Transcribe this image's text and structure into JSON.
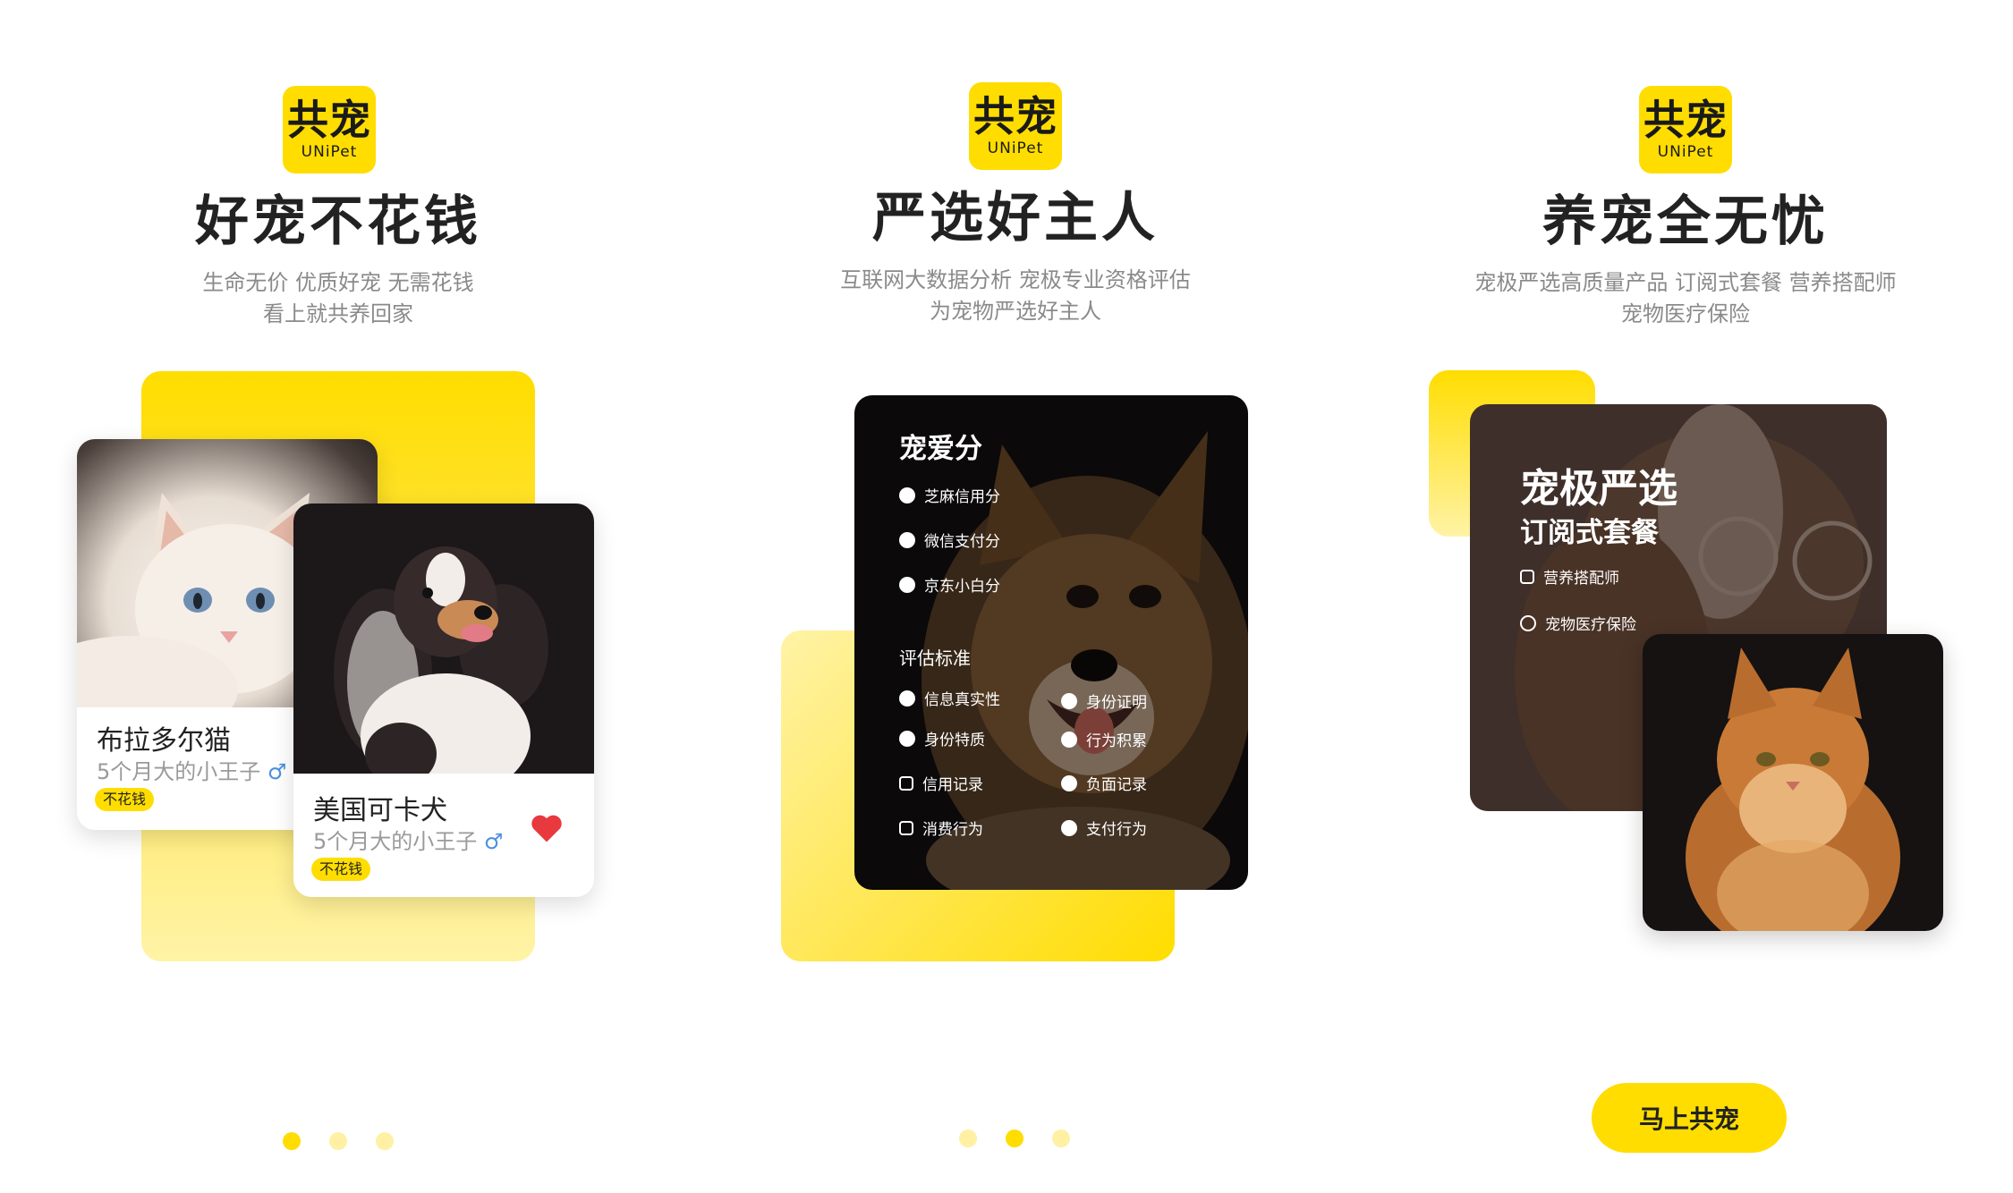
{
  "colors": {
    "brand_yellow": "#FFDD00",
    "light_yellow": "#FFF3A6",
    "text_dark": "#222222",
    "text_gray": "#8a8a8a",
    "heart_red": "#E8393E",
    "male_blue": "#4A90E2"
  },
  "logo": {
    "cn": "共宠",
    "en": "UNiPet"
  },
  "screen1": {
    "title": "好宠不花钱",
    "subtitle_line1": "生命无价  优质好宠  无需花钱",
    "subtitle_line2": "看上就共养回家",
    "cat_card": {
      "name": "布拉多尔猫",
      "desc": "5个月大的小王子",
      "gender": "♂",
      "badge": "不花钱"
    },
    "dog_card": {
      "name": "美国可卡犬",
      "desc": "5个月大的小王子",
      "gender": "♂",
      "badge": "不花钱",
      "heart_icon": "heart-icon"
    },
    "pager": {
      "total": 3,
      "active": 1
    }
  },
  "screen2": {
    "title": "严选好主人",
    "subtitle_line1": "互联网大数据分析  宠极专业资格评估",
    "subtitle_line2": "为宠物严选好主人",
    "score_title": "宠爱分",
    "score_items": [
      "芝麻信用分",
      "微信支付分",
      "京东小白分"
    ],
    "criteria_title": "评估标准",
    "criteria_left": [
      "信息真实性",
      "身份特质",
      "信用记录",
      "消费行为"
    ],
    "criteria_right": [
      "身份证明",
      "行为积累",
      "负面记录",
      "支付行为"
    ],
    "pager": {
      "total": 3,
      "active": 2
    }
  },
  "screen3": {
    "title": "养宠全无忧",
    "subtitle_line1": "宠极严选高质量产品  订阅式套餐  营养搭配师",
    "subtitle_line2": "宠物医疗保险",
    "card_title": "宠极严选",
    "card_subtitle": "订阅式套餐",
    "card_items": [
      "营养搭配师",
      "宠物医疗保险"
    ],
    "cta_button": "马上共宠"
  }
}
